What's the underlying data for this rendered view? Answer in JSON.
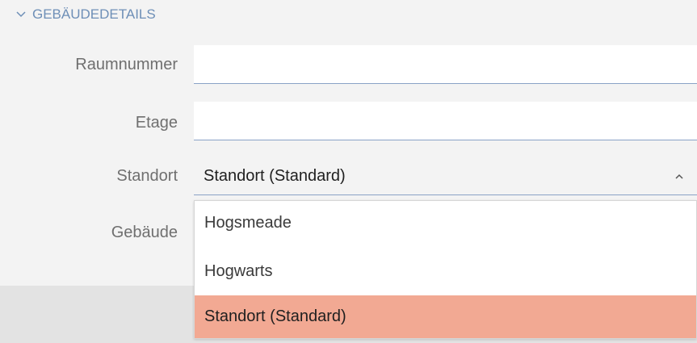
{
  "section": {
    "title": "GEBÄUDEDETAILS",
    "icon": "chevron-down-icon"
  },
  "fields": {
    "raumnummer": {
      "label": "Raumnummer",
      "value": "",
      "placeholder": ""
    },
    "etage": {
      "label": "Etage",
      "value": "",
      "placeholder": ""
    },
    "standort": {
      "label": "Standort",
      "value": "Standort (Standard)",
      "icon": "chevron-up-icon"
    },
    "gebaeude": {
      "label": "Gebäude"
    }
  },
  "dropdown": {
    "options": [
      {
        "label": "Hogsmeade",
        "selected": false
      },
      {
        "label": "Hogwarts",
        "selected": false
      },
      {
        "label": "Standort (Standard)",
        "selected": true
      }
    ]
  },
  "colors": {
    "accent": "#6e8fb7",
    "selected_option": "#f2a993",
    "input_underline": "#8aa2c6"
  }
}
